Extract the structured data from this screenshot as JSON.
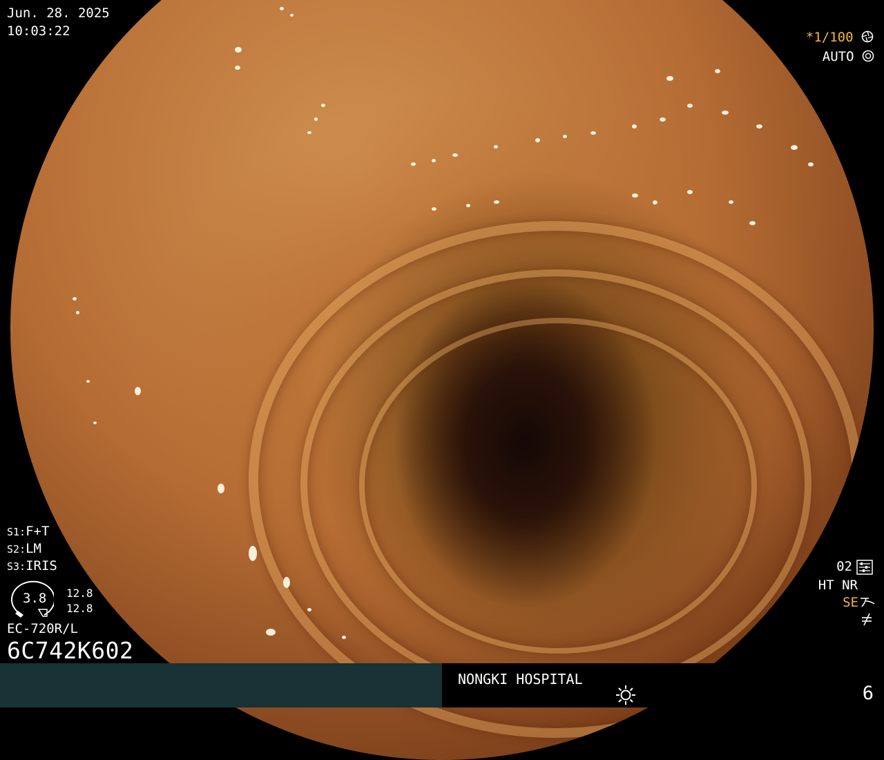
{
  "overlay": {
    "date": "Jun. 28. 2025",
    "time": "10:03:22",
    "shutter": "*1/100",
    "exposure_mode": "AUTO",
    "switches": [
      {
        "key": "S1:",
        "value": "F+T"
      },
      {
        "key": "S2:",
        "value": "LM"
      },
      {
        "key": "S3:",
        "value": "IRIS"
      }
    ],
    "gauge_value": "3.8",
    "gauge_readouts": [
      "12.8",
      "12.8"
    ],
    "scope_model": "EC-720R/L",
    "serial_number": "6C742K602",
    "enhancement_level": "02",
    "processing_modes": "HT NR",
    "se_mode": "SE",
    "hospital": "NONGKI HOSPITAL",
    "image_number": "6"
  },
  "icons": [
    "shutter-aperture-icon",
    "auto-exposure-icon",
    "enhancement-settings-icon",
    "se-wave-icon",
    "filter-off-icon",
    "brightness-sun-icon",
    "scope-gauge-icon"
  ],
  "colors": {
    "status_text": "#f5b833",
    "status_bar": "#183236",
    "background": "#000000"
  }
}
